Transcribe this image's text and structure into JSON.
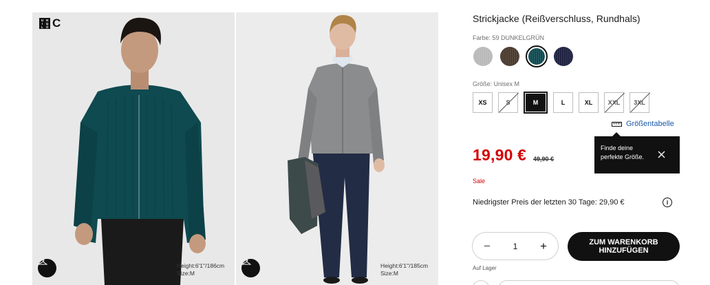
{
  "product": {
    "title": "Strickjacke (Reißverschluss, Rundhals)",
    "color_label": "Farbe: 59 DUNKELGRÜN",
    "size_label": "Größe: Unisex M",
    "size_guide": "Größentabelle",
    "price": "19,90 €",
    "old_price": "49,90 €",
    "sale": "Sale",
    "lowest_price": "Niedrigster Preis der letzten 30 Tage: 29,90 €",
    "stock": "Auf Lager"
  },
  "colors": [
    {
      "name": "grey",
      "hex": "#b9b9b9"
    },
    {
      "name": "brown",
      "hex": "#4a3a2e"
    },
    {
      "name": "dark-green",
      "hex": "#0f4b52",
      "selected": true
    },
    {
      "name": "navy",
      "hex": "#1e2240"
    }
  ],
  "sizes": [
    {
      "label": "XS",
      "state": "available"
    },
    {
      "label": "S",
      "state": "unavailable"
    },
    {
      "label": "M",
      "state": "selected"
    },
    {
      "label": "L",
      "state": "available"
    },
    {
      "label": "XL",
      "state": "available"
    },
    {
      "label": "XXL",
      "state": "unavailable"
    },
    {
      "label": "3XL",
      "state": "unavailable"
    }
  ],
  "tooltip": {
    "line1": "Finde deine",
    "line2": "perfekte Größe."
  },
  "cart": {
    "quantity": "1",
    "button_line1": "ZUM WARENKORB",
    "button_line2": "HINZUFÜGEN"
  },
  "gallery": {
    "logo_c": "C",
    "logo_letters": [
      "U",
      "N",
      "I",
      "Q",
      "L",
      "O"
    ],
    "photos": [
      {
        "height": "Height:6'1''/186cm",
        "size": "Size:M"
      },
      {
        "height": "Height:6'1''/185cm",
        "size": "Size:M"
      }
    ]
  },
  "accent": "#d20000"
}
